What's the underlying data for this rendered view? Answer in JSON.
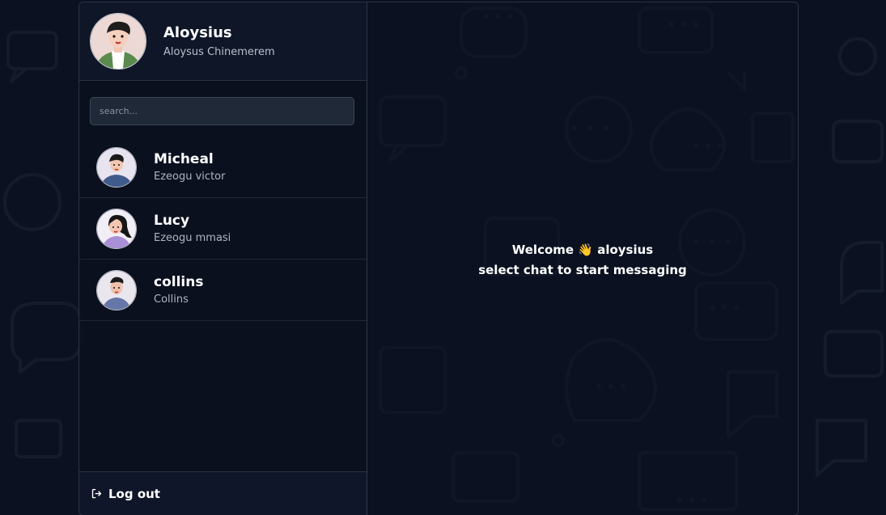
{
  "profile": {
    "name": "Aloysius",
    "full_name": "Aloysus Chinemerem"
  },
  "search": {
    "placeholder": "search..."
  },
  "contacts": [
    {
      "name": "Micheal",
      "subtitle": "Ezeogu victor"
    },
    {
      "name": "Lucy",
      "subtitle": "Ezeogu mmasi"
    },
    {
      "name": "collins",
      "subtitle": "Collins"
    }
  ],
  "logout": {
    "label": "Log out",
    "icon": "logout-icon"
  },
  "main": {
    "welcome_line": "Welcome 👋 aloysius",
    "prompt_line": "select chat to start messaging"
  },
  "colors": {
    "background": "#0b1120",
    "panel": "#0f172a",
    "search_bg": "#1f2937",
    "text_primary": "#ffffff",
    "text_secondary": "#b8c0cc"
  }
}
